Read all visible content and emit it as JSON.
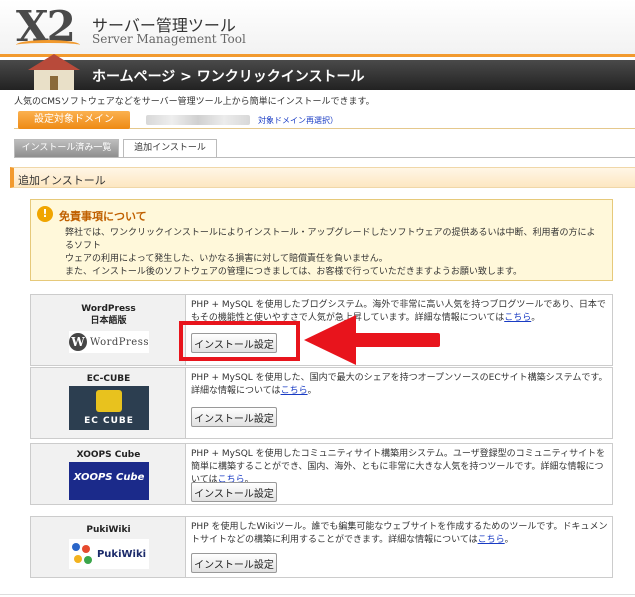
{
  "header": {
    "logo_text": "X2",
    "title": "サーバー管理ツール",
    "subtitle": "Server Management Tool"
  },
  "page": {
    "title": "ホームページ > ワンクリックインストール",
    "intro": "人気のCMSソフトウェアなどをサーバー管理ツール上から簡単にインストールできます。"
  },
  "domain": {
    "label": "設定対象ドメイン",
    "reselect_link": "対象ドメイン再選択）"
  },
  "tabs": [
    {
      "label": "インストール済み一覧",
      "active": false
    },
    {
      "label": "追加インストール",
      "active": true
    }
  ],
  "section": {
    "title": "追加インストール"
  },
  "disclaimer": {
    "icon": "warning-icon",
    "title": "免責事項について",
    "line1": "弊社では、ワンクリックインストールによりインストール・アップグレードしたソフトウェアの提供あるいは中断、利用者の方によるソフト",
    "line2": "ウェアの利用によって発生した、いかなる損害に対して賠償責任を負いません。",
    "line3": "また、インストール後のソフトウェアの管理につきましては、お客様で行っていただきますようお願い致します。"
  },
  "apps": [
    {
      "name": "WordPress\n日本語版",
      "name_line1": "WordPress",
      "name_line2": "日本語版",
      "logo_text": "WordPress",
      "desc": "PHP + MySQL を使用したブログシステム。海外で非常に高い人気を持つブログツールであり、日本でもその機能性と使いやすさで人気が急上昇しています。詳細な情報については",
      "link": "こちら",
      "desc_end": "。",
      "button": "インストール設定"
    },
    {
      "name_line1": "EC-CUBE",
      "logo_text": "EC CUBE",
      "desc": "PHP + MySQL を使用した、国内で最大のシェアを持つオープンソースのECサイト構築システムです。詳細な情報については",
      "link": "こちら",
      "desc_end": "。",
      "button": "インストール設定"
    },
    {
      "name_line1": "XOOPS Cube",
      "logo_text": "XOOPS Cube",
      "desc": "PHP + MySQL を使用したコミュニティサイト構築用システム。ユーザ登録型のコミュニティサイトを簡単に構築することができ、国内、海外、ともに非常に大きな人気を持つツールです。詳細な情報については",
      "link": "こちら",
      "desc_end": "。",
      "button": "インストール設定"
    },
    {
      "name_line1": "PukiWiki",
      "logo_text": "PukiWiki",
      "desc": "PHP を使用したWikiツール。誰でも編集可能なウェブサイトを作成するためのツールです。ドキュメントサイトなどの構築に利用することができます。詳細な情報については",
      "link": "こちら",
      "desc_end": "。",
      "button": "インストール設定"
    }
  ],
  "colors": {
    "accent_orange": "#f29a2e",
    "highlight_red": "#e8141c",
    "link_blue": "#1a3cc4"
  }
}
